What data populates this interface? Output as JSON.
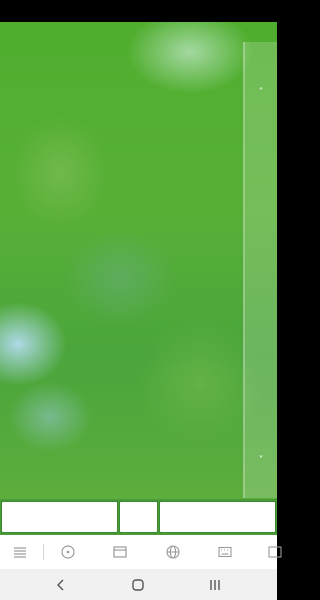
{
  "side_handle": {
    "up_icon": "chevron-up-icon",
    "down_icon": "chevron-down-icon",
    "up_glyph": "˄",
    "down_glyph": "˅"
  },
  "toolbar": {
    "icons": [
      "menu-icon",
      "compass-icon",
      "browser-window-icon",
      "globe-icon",
      "keyboard-icon",
      "text-edit-icon"
    ]
  },
  "navbar": {
    "icons": [
      "back-icon",
      "home-icon",
      "recents-icon"
    ]
  },
  "colors": {
    "accent": "#4a9a3a",
    "toolbar_bg": "#ffffff",
    "navbar_bg": "#f1f1f1"
  }
}
